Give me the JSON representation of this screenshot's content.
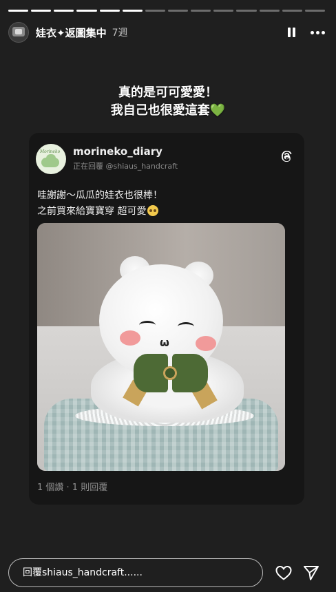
{
  "progress": {
    "total_segments": 14,
    "completed_segments": 6
  },
  "header": {
    "username": "娃衣✦返圖集中",
    "time_ago": "7週",
    "avatar_icon": "profile-avatar",
    "pause_icon": "pause-icon",
    "more_icon": "more-horizontal-icon"
  },
  "caption": {
    "line1": "真的是可可愛愛！",
    "line2": "我自己也很愛這套",
    "line2_emoji": "💚"
  },
  "card": {
    "author": "morineko_diary",
    "avatar_label": "Morineko",
    "replying_to": "正在回覆 @shiaus_handcraft",
    "text_line1": "哇謝謝～瓜瓜的娃衣也很棒！",
    "text_line2": "之前買來給寶寶穿 超可愛",
    "platform_icon": "threads-icon",
    "stats": "1 個讚 · 1 則回覆"
  },
  "reply_bar": {
    "placeholder": "回覆shiaus_handcraft......",
    "heart_icon": "heart-outline-icon",
    "send_icon": "send-icon"
  },
  "colors": {
    "background": "#1f1f1f",
    "card_background": "#161616",
    "accent_green": "#3ecb45"
  }
}
